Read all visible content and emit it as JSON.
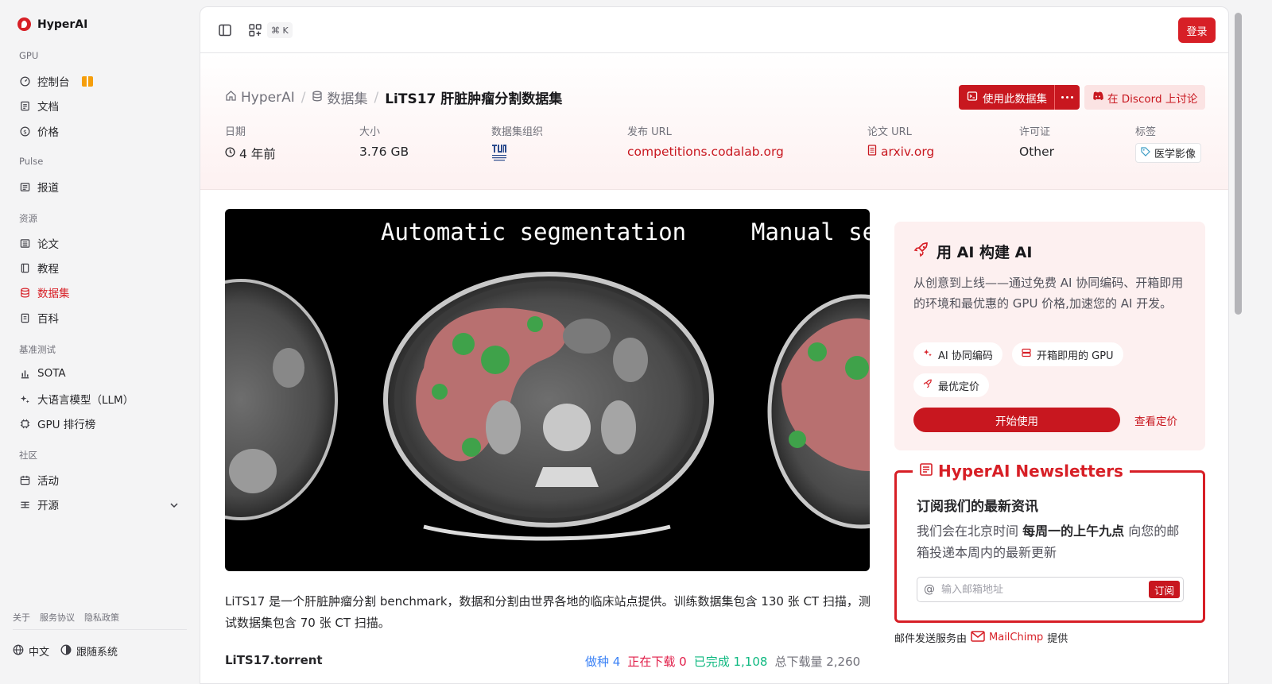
{
  "brand": {
    "name": "HyperAI"
  },
  "sidebar": {
    "sections": [
      {
        "title": "GPU",
        "items": [
          {
            "label": "控制台"
          },
          {
            "label": "文档"
          },
          {
            "label": "价格"
          }
        ]
      },
      {
        "title": "Pulse",
        "items": [
          {
            "label": "报道"
          }
        ]
      },
      {
        "title": "资源",
        "items": [
          {
            "label": "论文"
          },
          {
            "label": "教程"
          },
          {
            "label": "数据集"
          },
          {
            "label": "百科"
          }
        ]
      },
      {
        "title": "基准测试",
        "items": [
          {
            "label": "SOTA"
          },
          {
            "label": "大语言模型（LLM）"
          },
          {
            "label": "GPU 排行榜"
          }
        ]
      },
      {
        "title": "社区",
        "items": [
          {
            "label": "活动"
          },
          {
            "label": "开源"
          }
        ]
      }
    ],
    "active_item": "数据集",
    "footer_links": [
      "关于",
      "服务协议",
      "隐私政策"
    ],
    "language": "中文",
    "theme": "跟随系统"
  },
  "topbar": {
    "shortcut": "⌘ K",
    "login_label": "登录"
  },
  "breadcrumb": {
    "home": "HyperAI",
    "section": "数据集",
    "current": "LiTS17 肝脏肿瘤分割数据集"
  },
  "actions": {
    "use_label": "使用此数据集",
    "discord_label": "在 Discord 上讨论"
  },
  "meta": {
    "date_label": "日期",
    "date_value": "4 年前",
    "size_label": "大小",
    "size_value": "3.76 GB",
    "org_label": "数据集组织",
    "release_label": "发布 URL",
    "release_value": "competitions.codalab.org",
    "paper_label": "论文 URL",
    "paper_value": "arxiv.org",
    "license_label": "许可证",
    "license_value": "Other",
    "tags_label": "标签",
    "tag_value": "医学影像"
  },
  "hero": {
    "caption_left": "Automatic segmentation",
    "caption_right": "Manual se"
  },
  "description": "LiTS17 是一个肝脏肿瘤分割 benchmark，数据和分割由世界各地的临床站点提供。训练数据集包含 130 张 CT 扫描，测试数据集包含 70 张 CT 扫描。",
  "torrent": {
    "name": "LiTS17.torrent",
    "seeding_label": "做种",
    "seeding": "4",
    "downloading_label": "正在下载",
    "downloading": "0",
    "completed_label": "已完成",
    "completed": "1,108",
    "total_label": "总下载量",
    "total": "2,260"
  },
  "promo": {
    "title": "用 AI 构建 AI",
    "body": "从创意到上线——通过免费 AI 协同编码、开箱即用的环境和最优惠的 GPU 价格,加速您的 AI 开发。",
    "chips": [
      "AI 协同编码",
      "开箱即用的 GPU",
      "最优定价"
    ],
    "start_label": "开始使用",
    "pricing_label": "查看定价"
  },
  "newsletter": {
    "title": "HyperAI Newsletters",
    "subtitle": "订阅我们的最新资讯",
    "body_pre": "我们会在北京时间 ",
    "body_bold": "每周一的上午九点",
    "body_post": " 向您的邮箱投递本周内的最新更新",
    "email_placeholder": "输入邮箱地址",
    "subscribe_label": "订阅",
    "provider_pre": "邮件发送服务由",
    "provider_name": "MailChimp",
    "provider_post": "提供"
  },
  "colors": {
    "accent": "#d71f26",
    "seed": "#3b82f6",
    "downloading": "#e11d48",
    "completed": "#10b981"
  }
}
